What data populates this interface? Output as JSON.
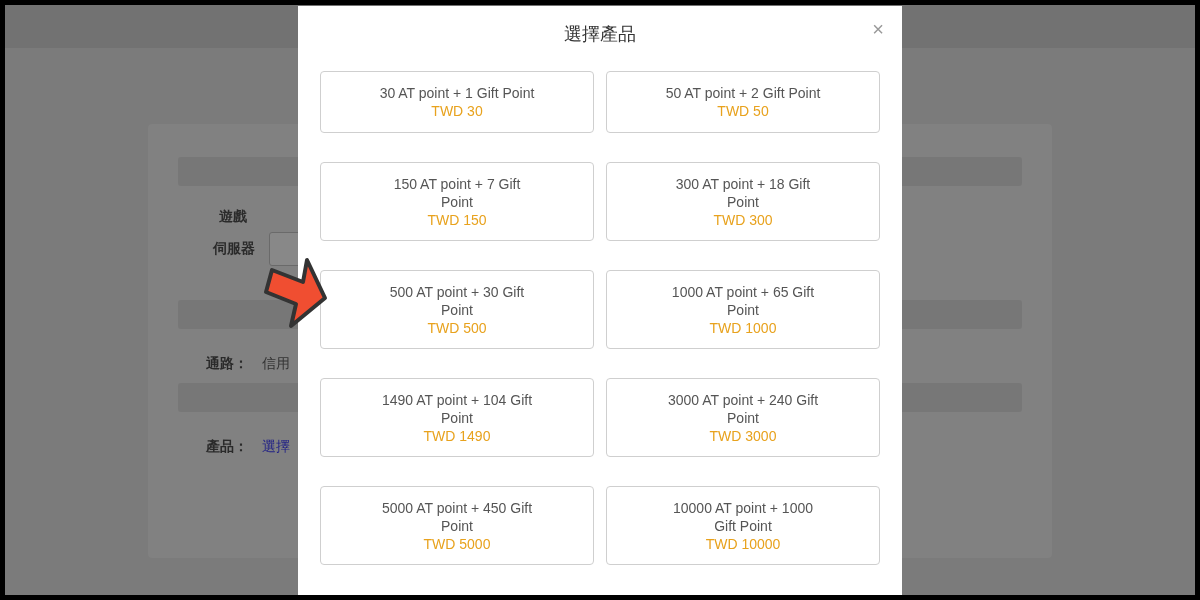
{
  "background": {
    "fields": [
      {
        "label": "遊戲",
        "kind": "label"
      },
      {
        "label": "伺服器",
        "kind": "select"
      }
    ],
    "channel": {
      "label": "通路：",
      "value": "信用"
    },
    "product": {
      "label": "產品：",
      "link": "選擇"
    }
  },
  "dialog": {
    "title": "選擇產品",
    "close": "×",
    "products": [
      {
        "name": "30 AT point + 1 Gift Point",
        "price": "TWD 30"
      },
      {
        "name": "50 AT point + 2 Gift Point",
        "price": "TWD 50"
      },
      {
        "name": "150 AT point + 7 Gift\nPoint",
        "price": "TWD 150"
      },
      {
        "name": "300 AT point + 18 Gift\nPoint",
        "price": "TWD 300"
      },
      {
        "name": "500 AT point + 30 Gift\nPoint",
        "price": "TWD 500"
      },
      {
        "name": "1000 AT point + 65 Gift\nPoint",
        "price": "TWD 1000"
      },
      {
        "name": "1490 AT point + 104 Gift\nPoint",
        "price": "TWD 1490"
      },
      {
        "name": "3000 AT point + 240 Gift\nPoint",
        "price": "TWD 3000"
      },
      {
        "name": "5000 AT point + 450 Gift\nPoint",
        "price": "TWD 5000"
      },
      {
        "name": "10000 AT point + 1000\nGift Point",
        "price": "TWD 10000"
      }
    ]
  }
}
